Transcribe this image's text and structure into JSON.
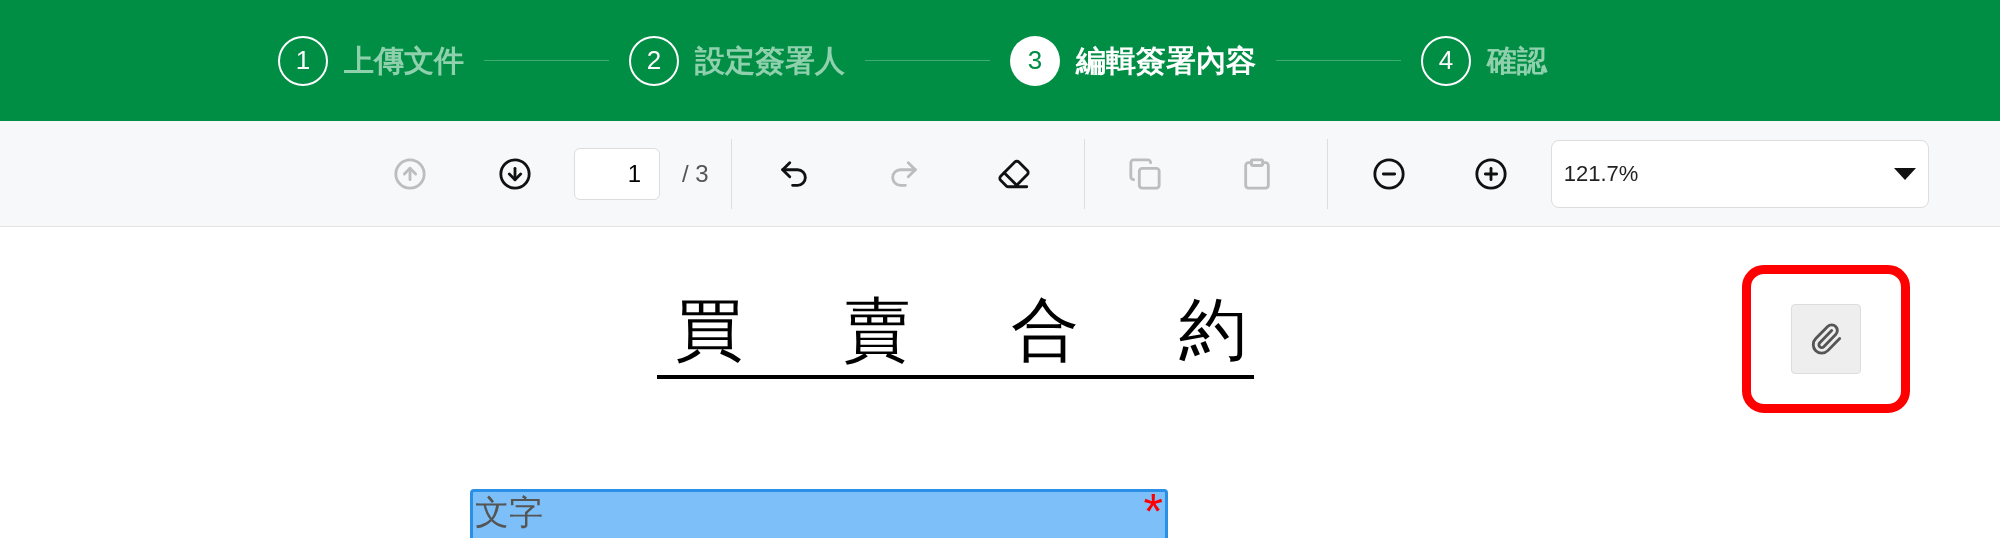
{
  "steps": [
    {
      "number": "1",
      "label": "上傳文件",
      "selected": false
    },
    {
      "number": "2",
      "label": "設定簽署人",
      "selected": false
    },
    {
      "number": "3",
      "label": "編輯簽署內容",
      "selected": true
    },
    {
      "number": "4",
      "label": "確認",
      "selected": false
    }
  ],
  "toolbar": {
    "prev_page": {
      "disabled": true
    },
    "next_page": {
      "disabled": false
    },
    "page_value": "1",
    "page_total": "/ 3",
    "undo": {
      "disabled": false
    },
    "redo": {
      "disabled": true
    },
    "erase": {
      "disabled": false
    },
    "copy": {
      "disabled": true
    },
    "paste": {
      "disabled": true
    },
    "zoom_out": {
      "disabled": false
    },
    "zoom_in": {
      "disabled": false
    },
    "zoom_value": "121.7%"
  },
  "document": {
    "title": "買賣合約",
    "attachment": {
      "highlighted": true
    },
    "fields": [
      {
        "label": "文字",
        "required": true,
        "required_mark": "*"
      }
    ]
  }
}
